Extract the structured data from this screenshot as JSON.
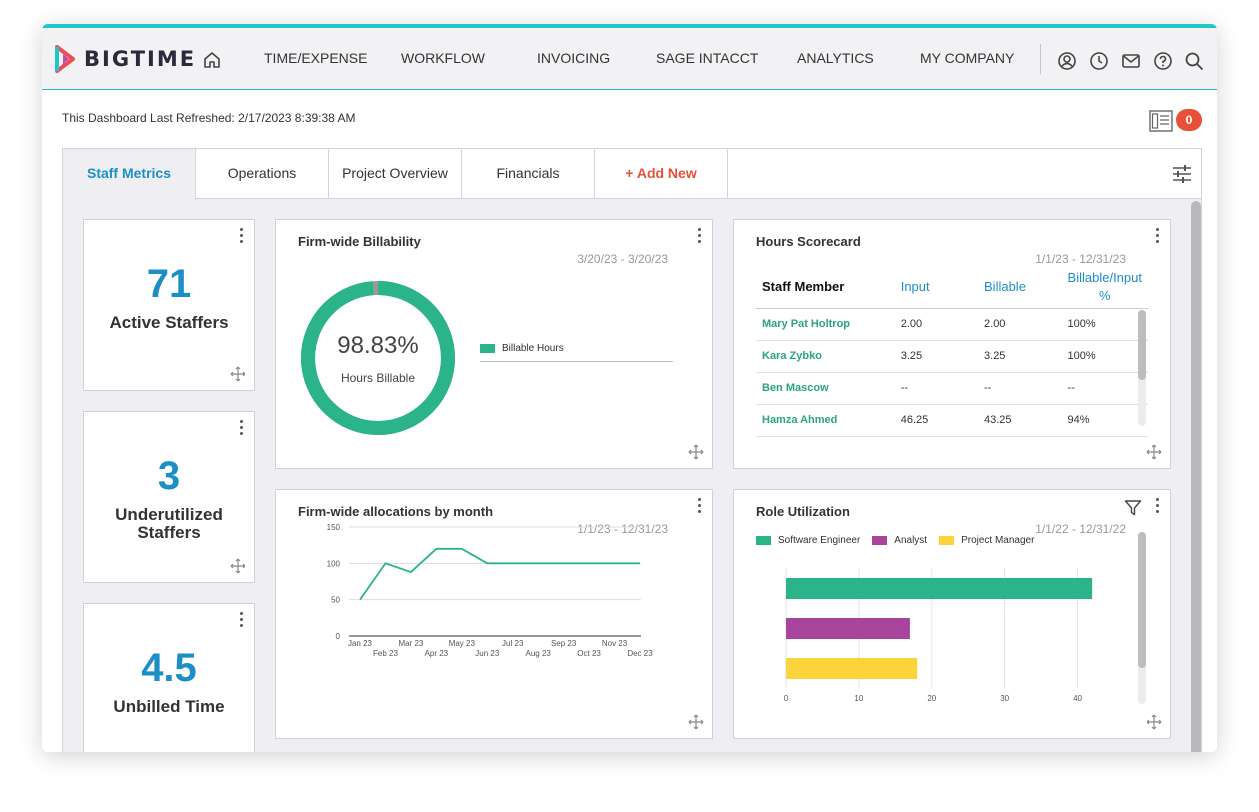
{
  "app": {
    "logo_text": "BIGTIME"
  },
  "nav": [
    "TIME/EXPENSE",
    "WORKFLOW",
    "INVOICING",
    "SAGE INTACCT",
    "ANALYTICS",
    "MY COMPANY"
  ],
  "header": {
    "refreshed": "This Dashboard Last Refreshed: 2/17/2023 8:39:38 AM",
    "badge_count": "0"
  },
  "tabs": [
    {
      "label": "Staff Metrics",
      "active": true
    },
    {
      "label": "Operations"
    },
    {
      "label": "Project Overview"
    },
    {
      "label": "Financials"
    },
    {
      "label": "+ Add New"
    }
  ],
  "metrics": [
    {
      "value": "71",
      "label": "Active Staffers"
    },
    {
      "value": "3",
      "label": "Underutilized Staffers"
    },
    {
      "value": "4.5",
      "label": "Unbilled Time"
    }
  ],
  "billability": {
    "title": "Firm-wide Billability",
    "date_range": "3/20/23 - 3/20/23",
    "percent_text": "98.83%",
    "center_label": "Hours Billable",
    "legend": "Billable Hours",
    "fraction": 0.9883
  },
  "scorecard": {
    "title": "Hours Scorecard",
    "date_range": "1/1/23 - 12/31/23",
    "headers": [
      "Staff Member",
      "Input",
      "Billable",
      "Billable/Input %"
    ],
    "rows": [
      [
        "Mary Pat Holtrop",
        "2.00",
        "2.00",
        "100%"
      ],
      [
        "Kara Zybko",
        "3.25",
        "3.25",
        "100%"
      ],
      [
        "Ben Mascow",
        "--",
        "--",
        "--"
      ],
      [
        "Hamza Ahmed",
        "46.25",
        "43.25",
        "94%"
      ]
    ]
  },
  "allocations": {
    "title": "Firm-wide allocations by month",
    "date_range": "1/1/23 - 12/31/23"
  },
  "role_util": {
    "title": "Role Utilization",
    "date_range": "1/1/22 - 12/31/22"
  },
  "colors": {
    "accent": "#1c8fc9",
    "green": "#2bb48a",
    "purple": "#a8449c",
    "yellow": "#fdd33b",
    "red": "#e8503a",
    "teal": "#1ec8c8"
  },
  "chart_data": [
    {
      "type": "line",
      "title": "Firm-wide allocations by month",
      "x": [
        "Jan 23",
        "Feb 23",
        "Mar 23",
        "Apr 23",
        "May 23",
        "Jun 23",
        "Jul 23",
        "Aug 23",
        "Sep 23",
        "Oct 23",
        "Nov 23",
        "Dec 23"
      ],
      "series": [
        {
          "values": [
            50,
            100,
            88,
            120,
            120,
            100,
            100,
            100,
            100,
            100,
            100,
            100
          ]
        }
      ],
      "yticks": [
        0,
        50,
        100,
        150
      ],
      "ylim": [
        0,
        150
      ],
      "grid": true
    },
    {
      "type": "bar",
      "orientation": "horizontal",
      "title": "Role Utilization",
      "categories": [
        "Software Engineer",
        "Analyst",
        "Project Manager"
      ],
      "series": [
        {
          "values": [
            42,
            17,
            18
          ]
        }
      ],
      "xticks": [
        0,
        10,
        20,
        30,
        40
      ],
      "xlim": [
        0,
        45
      ],
      "legend": "top-left",
      "grid": true
    }
  ]
}
